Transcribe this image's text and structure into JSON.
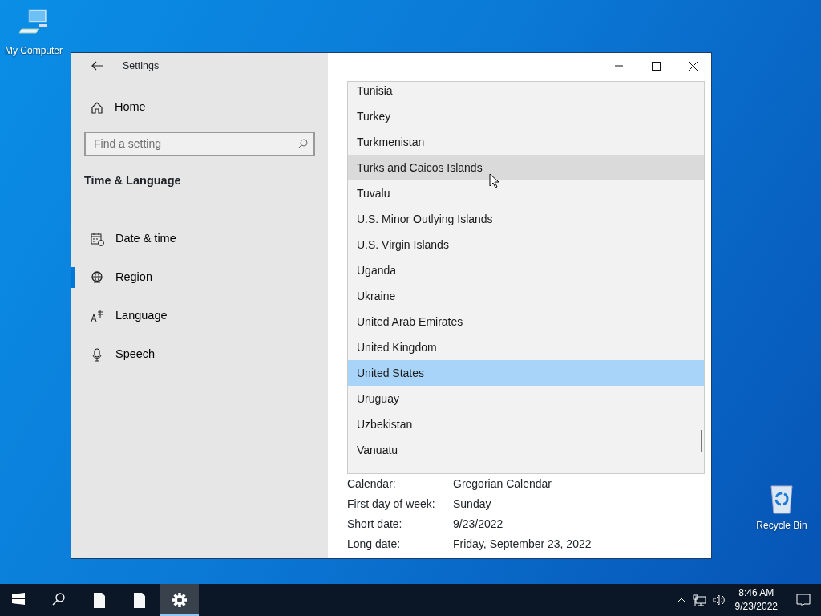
{
  "desktop_icons": [
    {
      "label": "My Computer",
      "kind": "computer"
    },
    {
      "label": "Recycle Bin",
      "kind": "recycle"
    }
  ],
  "window": {
    "title": "Settings",
    "home": "Home",
    "search": {
      "placeholder": "Find a setting"
    },
    "section": "Time & Language",
    "nav_items": [
      {
        "label": "Date & time",
        "kind": "calendar",
        "selected": false
      },
      {
        "label": "Region",
        "kind": "globe",
        "selected": true
      },
      {
        "label": "Language",
        "kind": "language",
        "selected": false
      },
      {
        "label": "Speech",
        "kind": "microphone",
        "selected": false
      }
    ]
  },
  "country_list": [
    {
      "name": "Tunisia",
      "hovered": false,
      "selected": false
    },
    {
      "name": "Turkey",
      "hovered": false,
      "selected": false
    },
    {
      "name": "Turkmenistan",
      "hovered": false,
      "selected": false
    },
    {
      "name": "Turks and Caicos Islands",
      "hovered": true,
      "selected": false
    },
    {
      "name": "Tuvalu",
      "hovered": false,
      "selected": false
    },
    {
      "name": "U.S. Minor Outlying Islands",
      "hovered": false,
      "selected": false
    },
    {
      "name": "U.S. Virgin Islands",
      "hovered": false,
      "selected": false
    },
    {
      "name": "Uganda",
      "hovered": false,
      "selected": false
    },
    {
      "name": "Ukraine",
      "hovered": false,
      "selected": false
    },
    {
      "name": "United Arab Emirates",
      "hovered": false,
      "selected": false
    },
    {
      "name": "United Kingdom",
      "hovered": false,
      "selected": false
    },
    {
      "name": "United States",
      "hovered": false,
      "selected": true
    },
    {
      "name": "Uruguay",
      "hovered": false,
      "selected": false
    },
    {
      "name": "Uzbekistan",
      "hovered": false,
      "selected": false
    },
    {
      "name": "Vanuatu",
      "hovered": false,
      "selected": false
    }
  ],
  "format_rows": [
    {
      "label": "Calendar:",
      "value": "Gregorian Calendar"
    },
    {
      "label": "First day of week:",
      "value": "Sunday"
    },
    {
      "label": "Short date:",
      "value": "9/23/2022"
    },
    {
      "label": "Long date:",
      "value": "Friday, September 23, 2022"
    }
  ],
  "taskbar": {
    "buttons": [
      {
        "kind": "start",
        "active": false
      },
      {
        "kind": "search",
        "active": false
      },
      {
        "kind": "document",
        "active": false
      },
      {
        "kind": "document",
        "active": false
      },
      {
        "kind": "settings",
        "active": true
      }
    ],
    "clock": {
      "time": "8:46 AM",
      "date": "9/23/2022"
    }
  }
}
